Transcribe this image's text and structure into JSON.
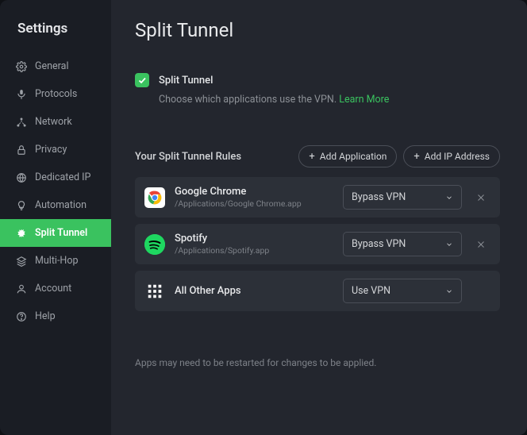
{
  "sidebar": {
    "title": "Settings",
    "items": [
      {
        "label": "General"
      },
      {
        "label": "Protocols"
      },
      {
        "label": "Network"
      },
      {
        "label": "Privacy"
      },
      {
        "label": "Dedicated IP"
      },
      {
        "label": "Automation"
      },
      {
        "label": "Split Tunnel"
      },
      {
        "label": "Multi-Hop"
      },
      {
        "label": "Account"
      },
      {
        "label": "Help"
      }
    ]
  },
  "page": {
    "title": "Split Tunnel",
    "enable_label": "Split Tunnel",
    "enable_desc_prefix": "Choose which applications use the VPN. ",
    "enable_learn": "Learn More",
    "rules_title": "Your Split Tunnel Rules",
    "add_app": "Add Application",
    "add_ip": "Add IP Address",
    "rules": [
      {
        "name": "Google Chrome",
        "path": "/Applications/Google Chrome.app",
        "mode": "Bypass VPN",
        "removable": true,
        "icon": "chrome"
      },
      {
        "name": "Spotify",
        "path": "/Applications/Spotify.app",
        "mode": "Bypass VPN",
        "removable": true,
        "icon": "spotify"
      },
      {
        "name": "All Other Apps",
        "path": "",
        "mode": "Use VPN",
        "removable": false,
        "icon": "grid"
      }
    ],
    "footer": "Apps may need to be restarted for changes to be applied."
  }
}
